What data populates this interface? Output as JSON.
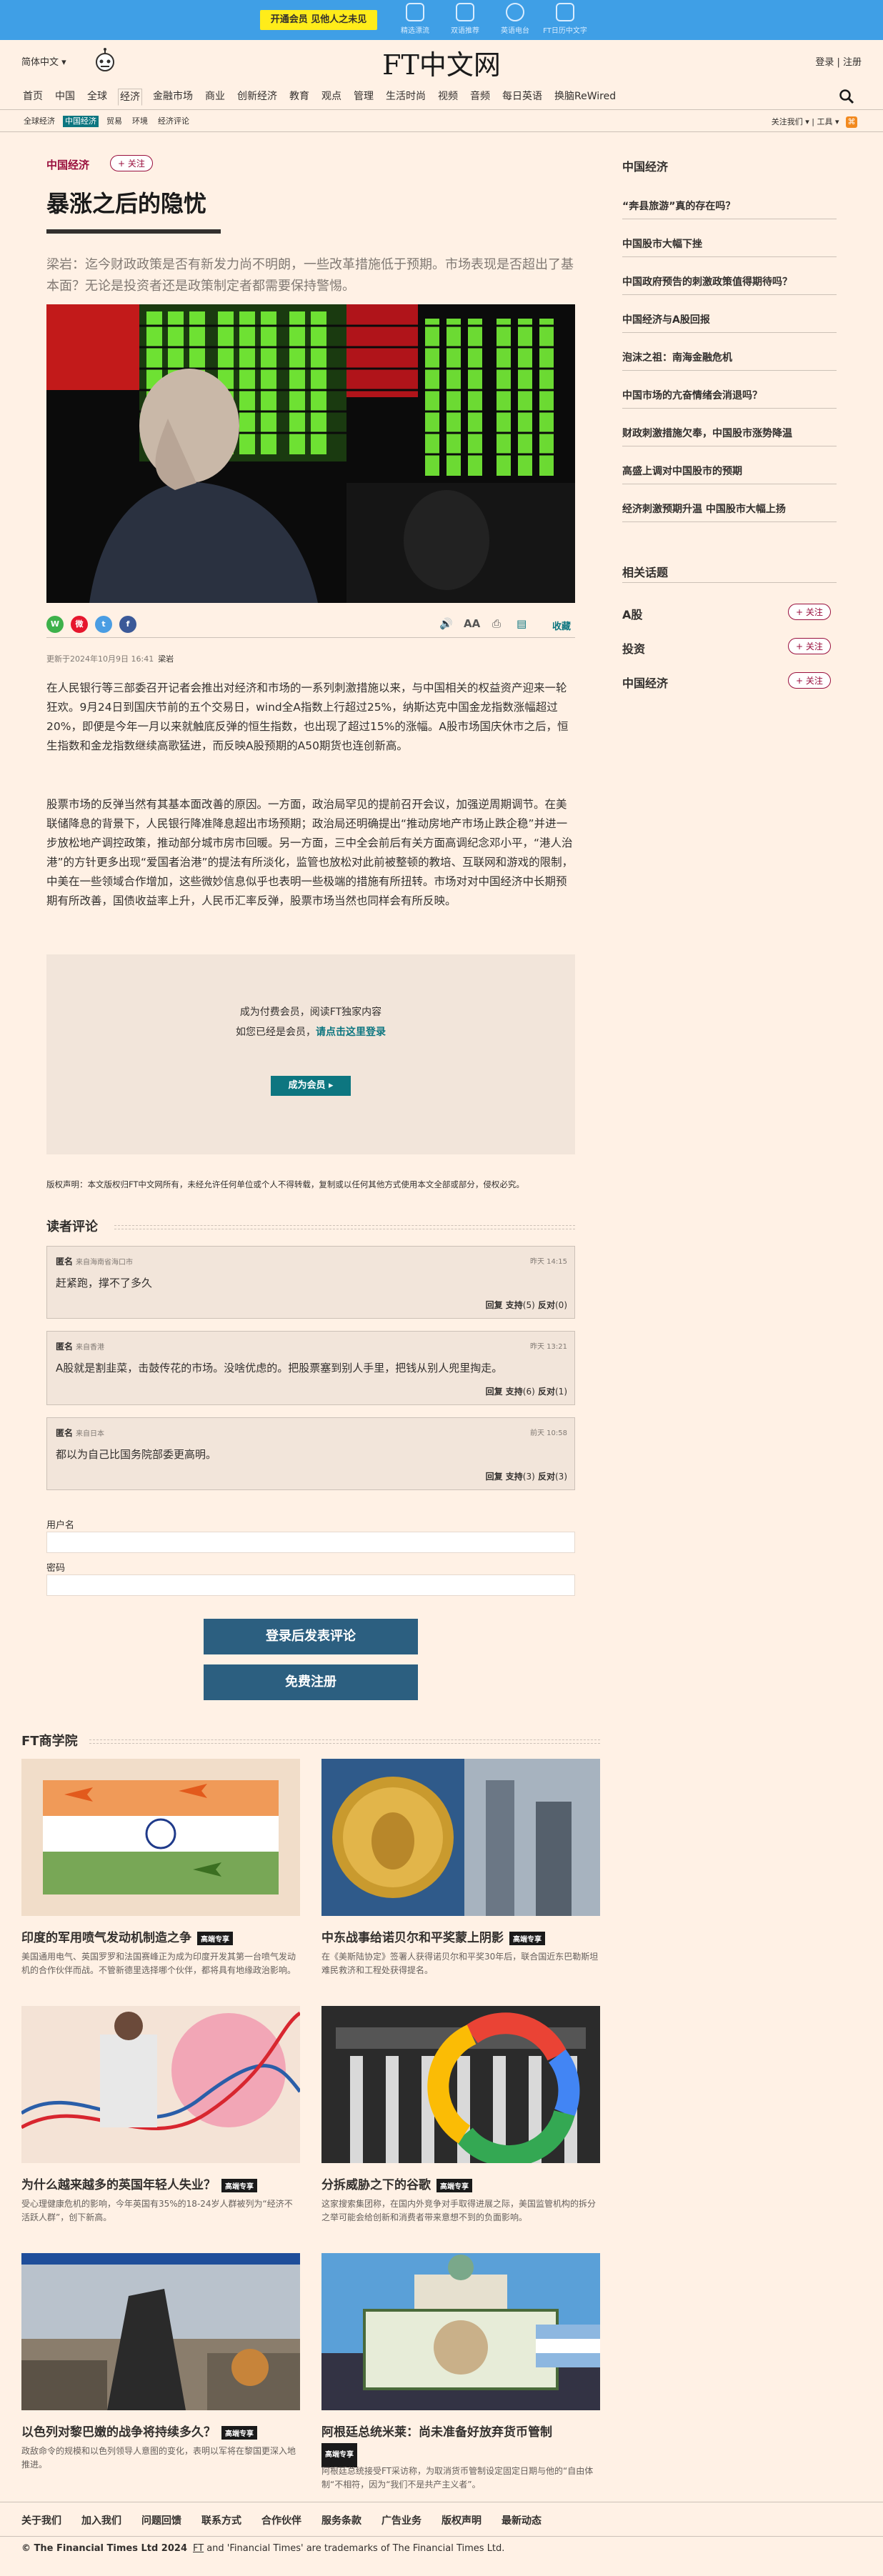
{
  "promo": {
    "button": "开通会员 见他人之未见"
  },
  "top_icons": [
    {
      "label": "精选漂流",
      "icon": "book-icon"
    },
    {
      "label": "双语推荐",
      "icon": "translate-icon"
    },
    {
      "label": "英语电台",
      "icon": "radio-icon"
    },
    {
      "label": "FT日历中文字",
      "icon": "calendar-icon"
    }
  ],
  "header": {
    "language": "简体中文",
    "logo": "FT中文网",
    "login": "登录",
    "register": "注册"
  },
  "nav": {
    "items": [
      "首页",
      "中国",
      "全球",
      "经济",
      "金融市场",
      "商业",
      "创新经济",
      "教育",
      "观点",
      "管理",
      "生活时尚",
      "视频",
      "音频",
      "每日英语",
      "换脑ReWired"
    ],
    "active": "经济"
  },
  "subnav": {
    "items": [
      "全球经济",
      "中国经济",
      "贸易",
      "环境",
      "经济评论"
    ],
    "active": "中国经济",
    "follow": "关注我们",
    "tools": "工具"
  },
  "article": {
    "tag": "中国经济",
    "follow": "+ 关注",
    "title": "暴涨之后的隐忧",
    "lead": "梁岩：迄今财政政策是否有新发力尚不明朗，一些改革措施低于预期。市场表现是否超出了基本面？无论是投资者还是政策制定者都需要保持警惕。",
    "share": [
      "WeChat",
      "Weibo",
      "Twitter",
      "Facebook"
    ],
    "collect": "收藏",
    "date": "更新于2024年10月9日 16:41",
    "author": "梁岩",
    "para1": "在人民银行等三部委召开记者会推出对经济和市场的一系列刺激措施以来，与中国相关的权益资产迎来一轮狂欢。9月24日到国庆节前的五个交易日，wind全A指数上行超过25%，纳斯达克中国金龙指数涨幅超过20%，即便是今年一月以来就触底反弹的恒生指数，也出现了超过15%的涨幅。A股市场国庆休市之后，恒生指数和金龙指数继续高歌猛进，而反映A股预期的A50期货也连创新高。",
    "para2": "股票市场的反弹当然有其基本面改善的原因。一方面，政治局罕见的提前召开会议，加强逆周期调节。在美联储降息的背景下，人民银行降准降息超出市场预期；政治局还明确提出“推动房地产市场止跌企稳”并进一步放松地产调控政策，推动部分城市房市回暖。另一方面，三中全会前后有关方面高调纪念邓小平，“港人治港”的方针更多出现“爱国者治港”的提法有所淡化，监管也放松对此前被整顿的教培、互联网和游戏的限制，中美在一些领域合作增加，这些微妙信息似乎也表明一些极端的措施有所扭转。市场对对中国经济中长期预期有所改善，国债收益率上升，人民币汇率反弹，股票市场当然也同样会有所反映。"
  },
  "paywall": {
    "line1": "成为付费会员，阅读FT独家内容",
    "line2_prefix": "如您已经是会员，",
    "line2_link": "请点击这里登录",
    "button": "成为会员 ▸"
  },
  "copyright": "版权声明：本文版权归FT中文网所有，未经允许任何单位或个人不得转载，复制或以任何其他方式使用本文全部或部分，侵权必究。",
  "comments": {
    "heading": "读者评论",
    "items": [
      {
        "user": "匿名",
        "location": "来自海南省海口市",
        "time": "昨天 14:15",
        "text": "赶紧跑，撑不了多久",
        "reply": "回复",
        "support": "支持",
        "support_count": "(5)",
        "oppose": "反对",
        "oppose_count": "(0)"
      },
      {
        "user": "匿名",
        "location": "来自香港",
        "time": "昨天 13:21",
        "text": "A股就是割韭菜，击鼓传花的市场。没啥优虑的。把股票塞到别人手里，把钱从别人兜里掏走。",
        "reply": "回复",
        "support": "支持",
        "support_count": "(6)",
        "oppose": "反对",
        "oppose_count": "(1)"
      },
      {
        "user": "匿名",
        "location": "来自日本",
        "time": "前天 10:58",
        "text": "都以为自己比国务院部委更高明。",
        "reply": "回复",
        "support": "支持",
        "support_count": "(3)",
        "oppose": "反对",
        "oppose_count": "(3)"
      }
    ],
    "username_label": "用户名",
    "password_label": "密码",
    "post_button": "登录后发表评论",
    "register_button": "免费注册"
  },
  "sidebar": {
    "heading": "中国经济",
    "items": [
      "“奔县旅游”真的存在吗？",
      "中国股市大幅下挫",
      "中国政府预告的刺激政策值得期待吗？",
      "中国经济与A股回报",
      "泡沫之祖：南海金融危机",
      "中国市场的亢奋情绪会消退吗？",
      "财政刺激措施欠奉，中国股市涨势降温",
      "高盛上调对中国股市的预期",
      "经济刺激预期升温 中国股市大幅上扬"
    ],
    "topics_heading": "相关话题",
    "topics": [
      "A股",
      "投资",
      "中国经济"
    ],
    "topic_follow": "+ 关注"
  },
  "business": {
    "heading": "FT商学院",
    "badge": "高端专享",
    "cards": [
      {
        "title": "印度的军用喷气发动机制造之争",
        "desc": "美国通用电气、英国罗罗和法国赛峰正为成为印度开发其第一台喷气发动机的合作伙伴而战。不管新德里选择哪个伙伴，都将具有地缘政治影响。"
      },
      {
        "title": "中东战事给诺贝尔和平奖蒙上阴影",
        "desc": "在《美斯陆协定》签署人获得诺贝尔和平奖30年后，联合国近东巴勒斯坦难民救济和工程处获得提名。"
      },
      {
        "title": "为什么越来越多的英国年轻人失业？",
        "desc": "受心理健康危机的影响，今年英国有35%的18-24岁人群被列为“经济不活跃人群”，创下新高。"
      },
      {
        "title": "分拆威胁之下的谷歌",
        "desc": "这家搜索集团称，在国内外竞争对手取得进展之际，美国监管机构的拆分之举可能会给创新和消费者带来意想不到的负面影响。"
      },
      {
        "title": "以色列对黎巴嫩的战争将持续多久？",
        "desc": "政敌命令的规模和以色列领导人意图的变化，表明以军将在黎国更深入地推进。"
      },
      {
        "title": "阿根廷总统米莱：尚未准备好放弃货币管制",
        "desc": "阿根廷总统接受FT采访称，为取消货币管制设定固定日期与他的“自由体制“不相符，因为“我们不是共产主义者”。"
      }
    ]
  },
  "footer": {
    "links": [
      "关于我们",
      "加入我们",
      "问题回馈",
      "联系方式",
      "合作伙伴",
      "服务条款",
      "广告业务",
      "版权声明",
      "最新动态"
    ],
    "copyright": "© The Financial Times Ltd 2024",
    "trademark_a": "FT",
    "trademark_b": "and 'Financial Times' are trademarks of The Financial Times Ltd."
  },
  "colors": {
    "brand": "#990F3D",
    "teal": "#0D7680",
    "paper": "#FFF1E5",
    "topbar": "#3F9FE6",
    "button_blue": "#2C5F80"
  }
}
